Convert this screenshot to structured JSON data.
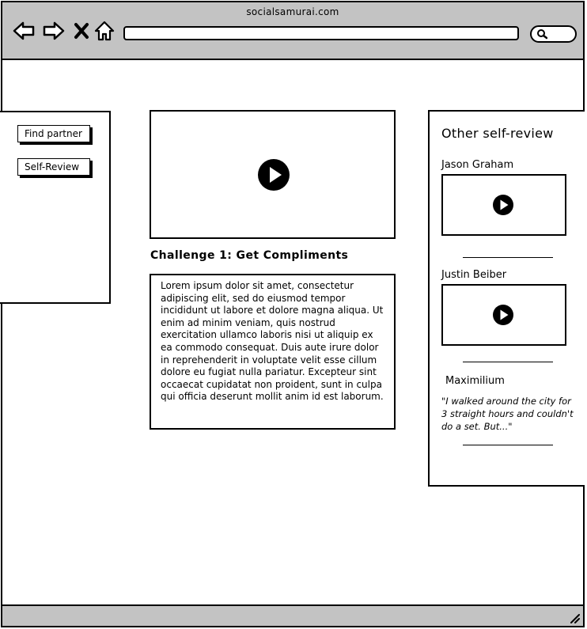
{
  "browser": {
    "site_title": "socialsamurai.com",
    "icons": [
      "back-arrow-icon",
      "forward-arrow-icon",
      "close-icon",
      "home-icon",
      "search-icon",
      "resize-grip-icon"
    ]
  },
  "sidebar": {
    "buttons": [
      {
        "label": "Find partner"
      },
      {
        "label": "Self-Review"
      }
    ]
  },
  "main": {
    "challenge_title": "Challenge 1: Get Compliments",
    "body_text": "Lorem ipsum dolor sit amet, consectetur adipiscing elit, sed do eiusmod tempor incididunt ut labore et dolore magna aliqua. Ut enim ad minim veniam, quis nostrud exercitation ullamco laboris nisi ut aliquip ex ea commodo consequat. Duis aute irure dolor in reprehenderit in voluptate velit esse cillum dolore eu fugiat nulla pariatur. Excepteur sint occaecat cupidatat non proident, sunt in culpa qui officia deserunt mollit anim id est laborum."
  },
  "reviews": {
    "title": "Other self-review",
    "items": [
      {
        "name": "Jason Graham"
      },
      {
        "name": "Justin Beiber"
      },
      {
        "name": "Maximilium",
        "quote": "\"I walked around the city for 3 straight hours and couldn't do a set. But...\""
      }
    ]
  },
  "colors": {
    "chrome": "#c3c3c3",
    "ink": "#000000",
    "background": "#ffffff"
  }
}
